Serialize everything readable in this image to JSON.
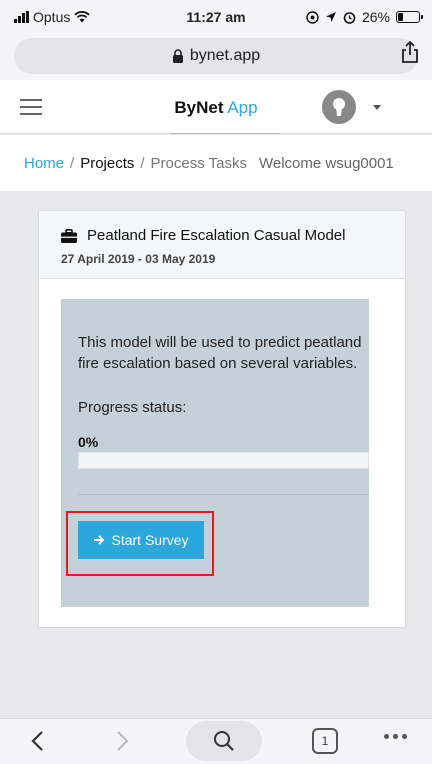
{
  "status_bar": {
    "carrier": "Optus",
    "time": "11:27 am",
    "battery": "26%",
    "battery_level": 0.26
  },
  "browser": {
    "url": "bynet.app"
  },
  "navbar": {
    "brand_primary": "ByNet",
    "brand_secondary": "App",
    "menu_icon": "hamburger-icon",
    "avatar_icon": "avatar-icon"
  },
  "breadcrumb": {
    "home": "Home",
    "separator": "/",
    "projects": "Projects",
    "process_tasks": "Process Tasks",
    "welcome": "Welcome wsug0001"
  },
  "card": {
    "title": "Peatland Fire Escalation Casual Model",
    "date_range": "27 April 2019 - 03 May 2019",
    "description": "This model will be used to predict peatland fire escalation based on several variables.",
    "progress_label": "Progress status:",
    "progress_percent": "0%",
    "progress_value": 0,
    "start_button_label": "Start Survey"
  },
  "colors": {
    "accent": "#2ba7db",
    "panel_bg": "#c5d1d9",
    "highlight": "#e31b1b"
  },
  "toolbar": {
    "tabs_count": "1"
  }
}
